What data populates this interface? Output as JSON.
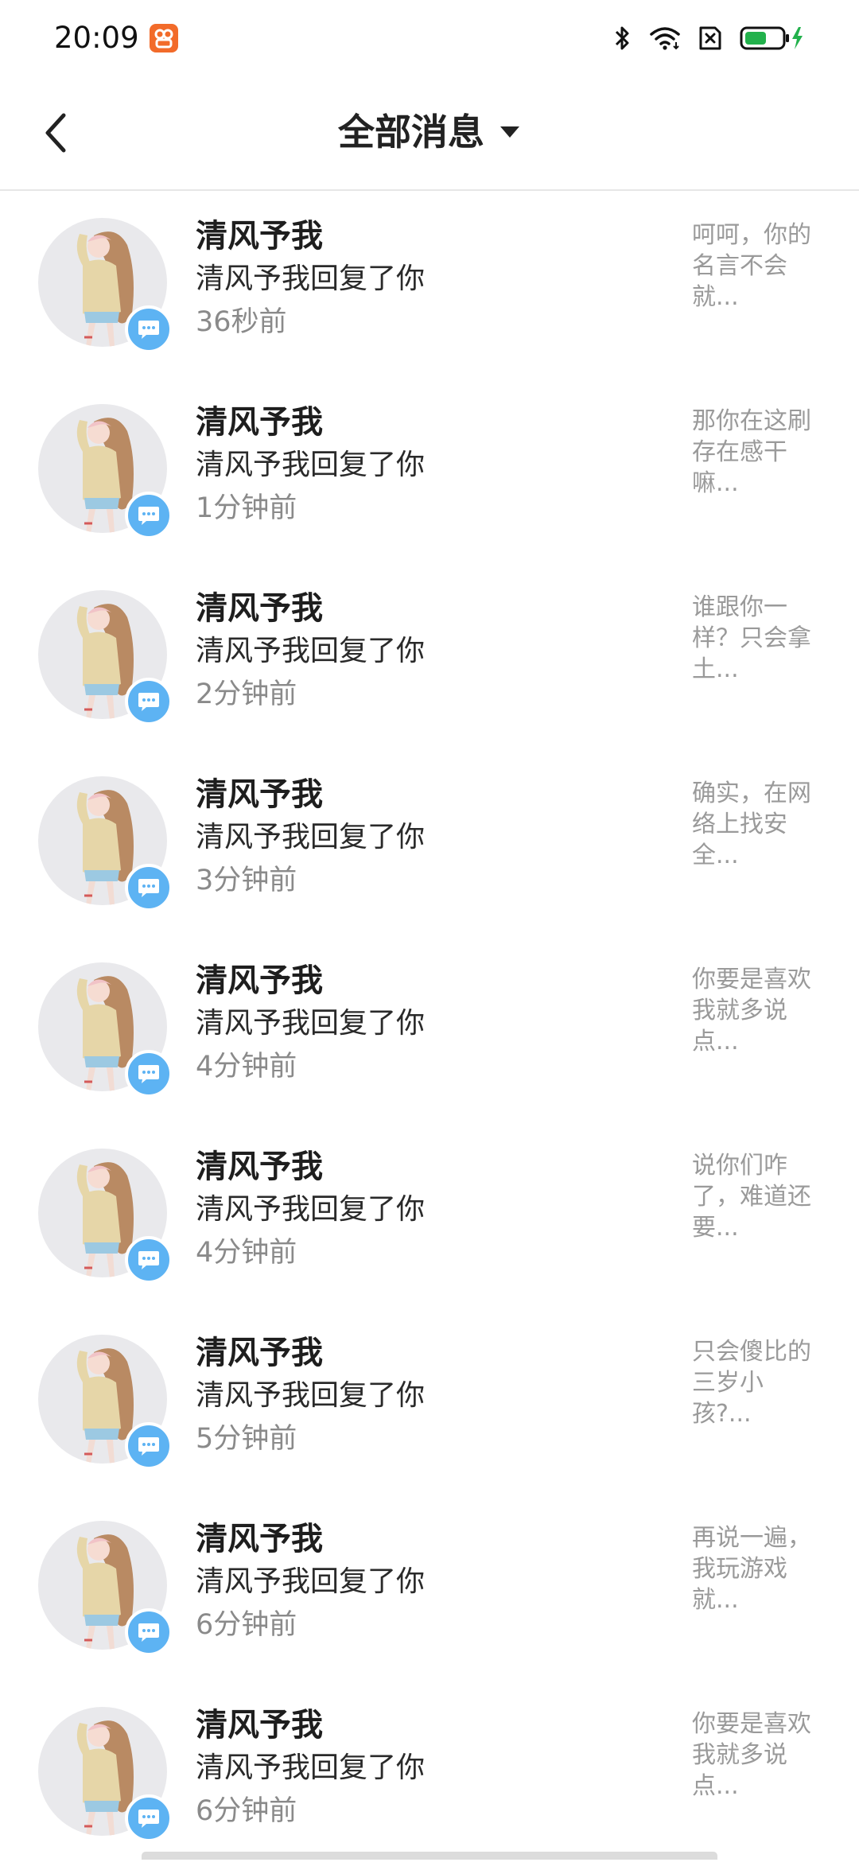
{
  "status_bar": {
    "time": "20:09",
    "app_icon": "orange-app-icon",
    "icons": [
      "bluetooth-icon",
      "wifi-icon",
      "sim-off-icon",
      "battery-charging-icon"
    ],
    "battery_color": "#22b14c"
  },
  "header": {
    "back_icon": "chevron-left-icon",
    "title": "全部消息",
    "dropdown_icon": "caret-down-icon"
  },
  "colors": {
    "badge": "#5db3f3",
    "avatar_bg": "#e9e9ec",
    "name": "#1e1e1e",
    "time": "#8a8a8a",
    "preview": "#9a9a9a"
  },
  "messages": [
    {
      "name": "清风予我",
      "action": "清风予我回复了你",
      "time": "36秒前",
      "preview": "呵呵，你的\n名言不会\n就..."
    },
    {
      "name": "清风予我",
      "action": "清风予我回复了你",
      "time": "1分钟前",
      "preview": "那你在这刷\n存在感干\n嘛..."
    },
    {
      "name": "清风予我",
      "action": "清风予我回复了你",
      "time": "2分钟前",
      "preview": "谁跟你一\n样？只会拿\n土..."
    },
    {
      "name": "清风予我",
      "action": "清风予我回复了你",
      "time": "3分钟前",
      "preview": "确实，在网\n络上找安\n全..."
    },
    {
      "name": "清风予我",
      "action": "清风予我回复了你",
      "time": "4分钟前",
      "preview": "你要是喜欢\n我就多说\n点..."
    },
    {
      "name": "清风予我",
      "action": "清风予我回复了你",
      "time": "4分钟前",
      "preview": "说你们咋\n了，难道还\n要..."
    },
    {
      "name": "清风予我",
      "action": "清风予我回复了你",
      "time": "5分钟前",
      "preview": "只会傻比的\n三岁小孩?..."
    },
    {
      "name": "清风予我",
      "action": "清风予我回复了你",
      "time": "6分钟前",
      "preview": "再说一遍，\n我玩游戏\n就..."
    },
    {
      "name": "清风予我",
      "action": "清风予我回复了你",
      "time": "6分钟前",
      "preview": "你要是喜欢\n我就多说\n点..."
    }
  ]
}
